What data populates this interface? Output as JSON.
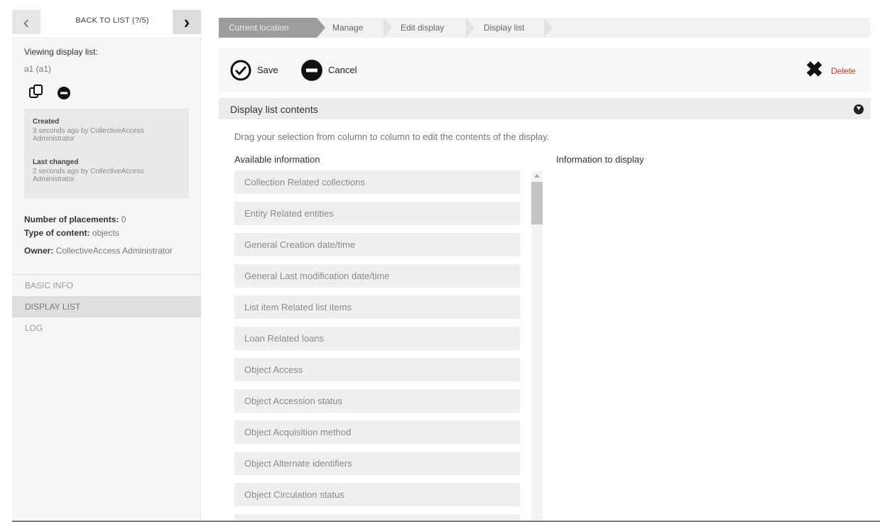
{
  "sidebar": {
    "back_label": "BACK TO LIST (?/5)",
    "prev_icon": "chevron-left-icon",
    "next_icon": "chevron-right-icon",
    "viewing_title": "Viewing display list:",
    "viewing_name": "a1 (a1)",
    "info": {
      "created_label": "Created",
      "created_text": "3 seconds ago by CollectiveAccess Administrator",
      "changed_label": "Last changed",
      "changed_text": "2 seconds ago by CollectiveAccess Administrator"
    },
    "placements_label": "Number of placements:",
    "placements_value": "0",
    "content_label": "Type of content:",
    "content_value": "objects",
    "owner_label": "Owner:",
    "owner_value": "CollectiveAccess Administrator",
    "nav": [
      {
        "label": "BASIC INFO"
      },
      {
        "label": "DISPLAY LIST"
      },
      {
        "label": "LOG"
      }
    ]
  },
  "breadcrumb": [
    "Current location",
    "Manage",
    "Edit display",
    "Display list"
  ],
  "toolbar": {
    "save_label": "Save",
    "cancel_label": "Cancel",
    "delete_label": "Delete"
  },
  "section": {
    "title": "Display list contents",
    "instructions": "Drag your selection from column to column to edit the contents of the display.",
    "available_title": "Available information",
    "display_title": "Information to display"
  },
  "available_items": [
    "Collection Related collections",
    "Entity Related entities",
    "General Creation date/time",
    "General Last modification date/time",
    "List item Related list items",
    "Loan Related loans",
    "Object Access",
    "Object Accession status",
    "Object Acquisition method",
    "Object Alternate identifiers",
    "Object Circulation status",
    ""
  ],
  "colors": {
    "accent_delete": "#e0302a",
    "breadcrumb_current": "#9d9d9d",
    "active_nav": "#dedede"
  }
}
